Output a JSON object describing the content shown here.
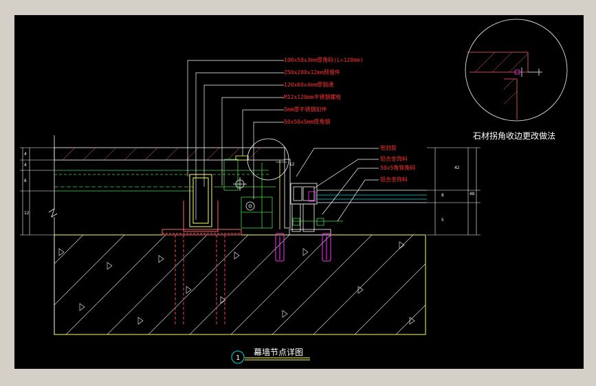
{
  "drawing": {
    "title": "幕墙节点详图",
    "detail_number": "1",
    "corner_note": "石材拐角收边更改做法"
  },
  "callouts_left": [
    "100x50x3mm厚角码(L=120mm)",
    "250x200x12mm预埋件",
    "120x60x4mm厚钢通",
    "M12x120mm不锈钢螺栓",
    "5mm厚不锈钢扣件",
    "50x50x5mm厚角钢"
  ],
  "callouts_right": [
    "密封胶",
    "铝合金饰料",
    "50x5角铁角码",
    "铝合金饰料"
  ],
  "colors": {
    "background": "#000000",
    "frame": "#d4d0c8",
    "concrete_outline": "#ffff66",
    "callout_text": "#ff3030",
    "leader": "#ffffff",
    "green": "#44dd44",
    "magenta": "#ff33ff",
    "cyan": "#00dddd"
  }
}
